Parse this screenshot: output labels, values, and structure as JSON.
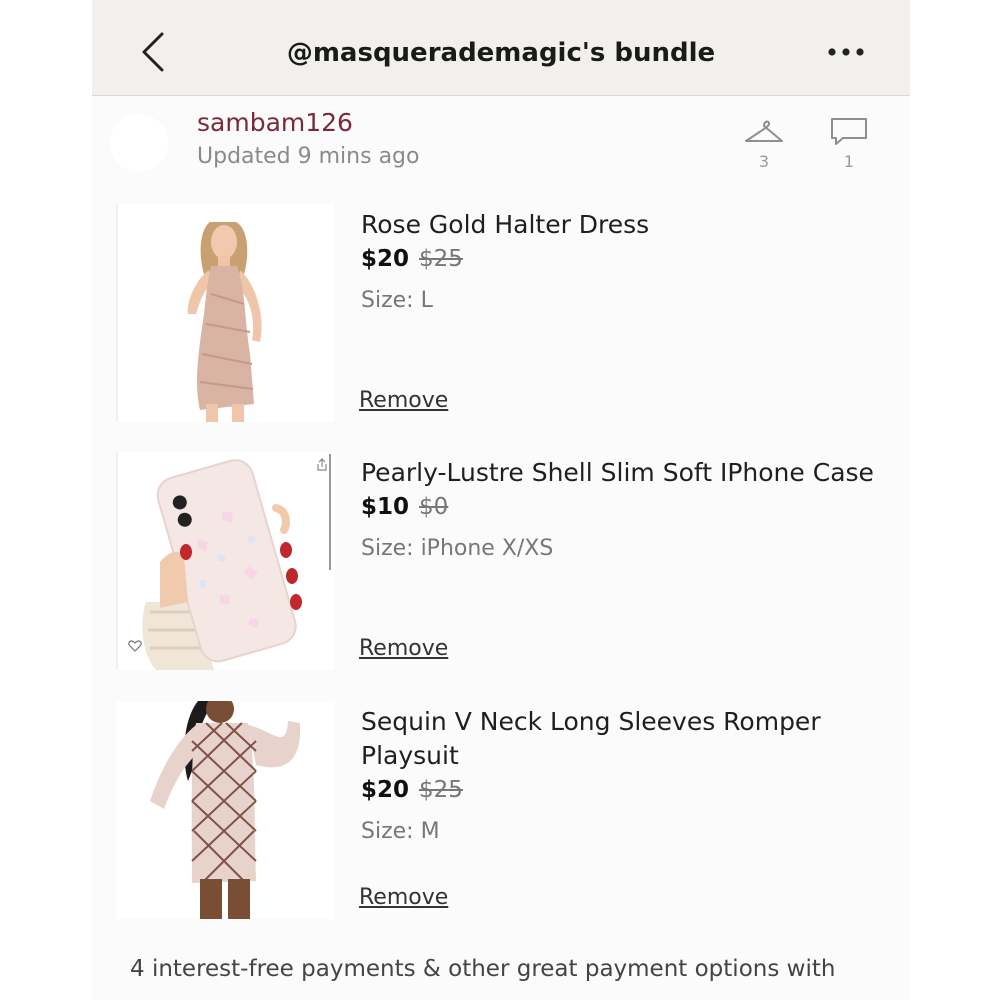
{
  "header": {
    "title": "@masquerademagic's bundle"
  },
  "seller": {
    "username": "sambam126",
    "updated": "Updated 9 mins ago",
    "likes_count": "3",
    "comments_count": "1"
  },
  "items": [
    {
      "name": "Rose Gold Halter Dress",
      "price": "$20",
      "original_price": "$25",
      "size": "Size: L",
      "remove_label": "Remove"
    },
    {
      "name": "Pearly-Lustre Shell Slim Soft IPhone Case",
      "price": "$10",
      "original_price": "$0",
      "size": "Size: iPhone X/XS",
      "remove_label": "Remove"
    },
    {
      "name": "Sequin V Neck Long Sleeves Romper Playsuit",
      "price": "$20",
      "original_price": "$25",
      "size": "Size: M",
      "remove_label": "Remove"
    }
  ],
  "footer": {
    "payment_note": "4 interest-free payments & other great payment options with"
  },
  "colors": {
    "header_bg": "#f1f0ec",
    "seller_name": "#7b2a3a",
    "rose_gold": "#d9b3a3"
  },
  "icons": [
    "back-arrow-icon",
    "more-dots-icon",
    "hanger-icon",
    "comment-bubble-icon",
    "heart-icon",
    "share-icon"
  ]
}
